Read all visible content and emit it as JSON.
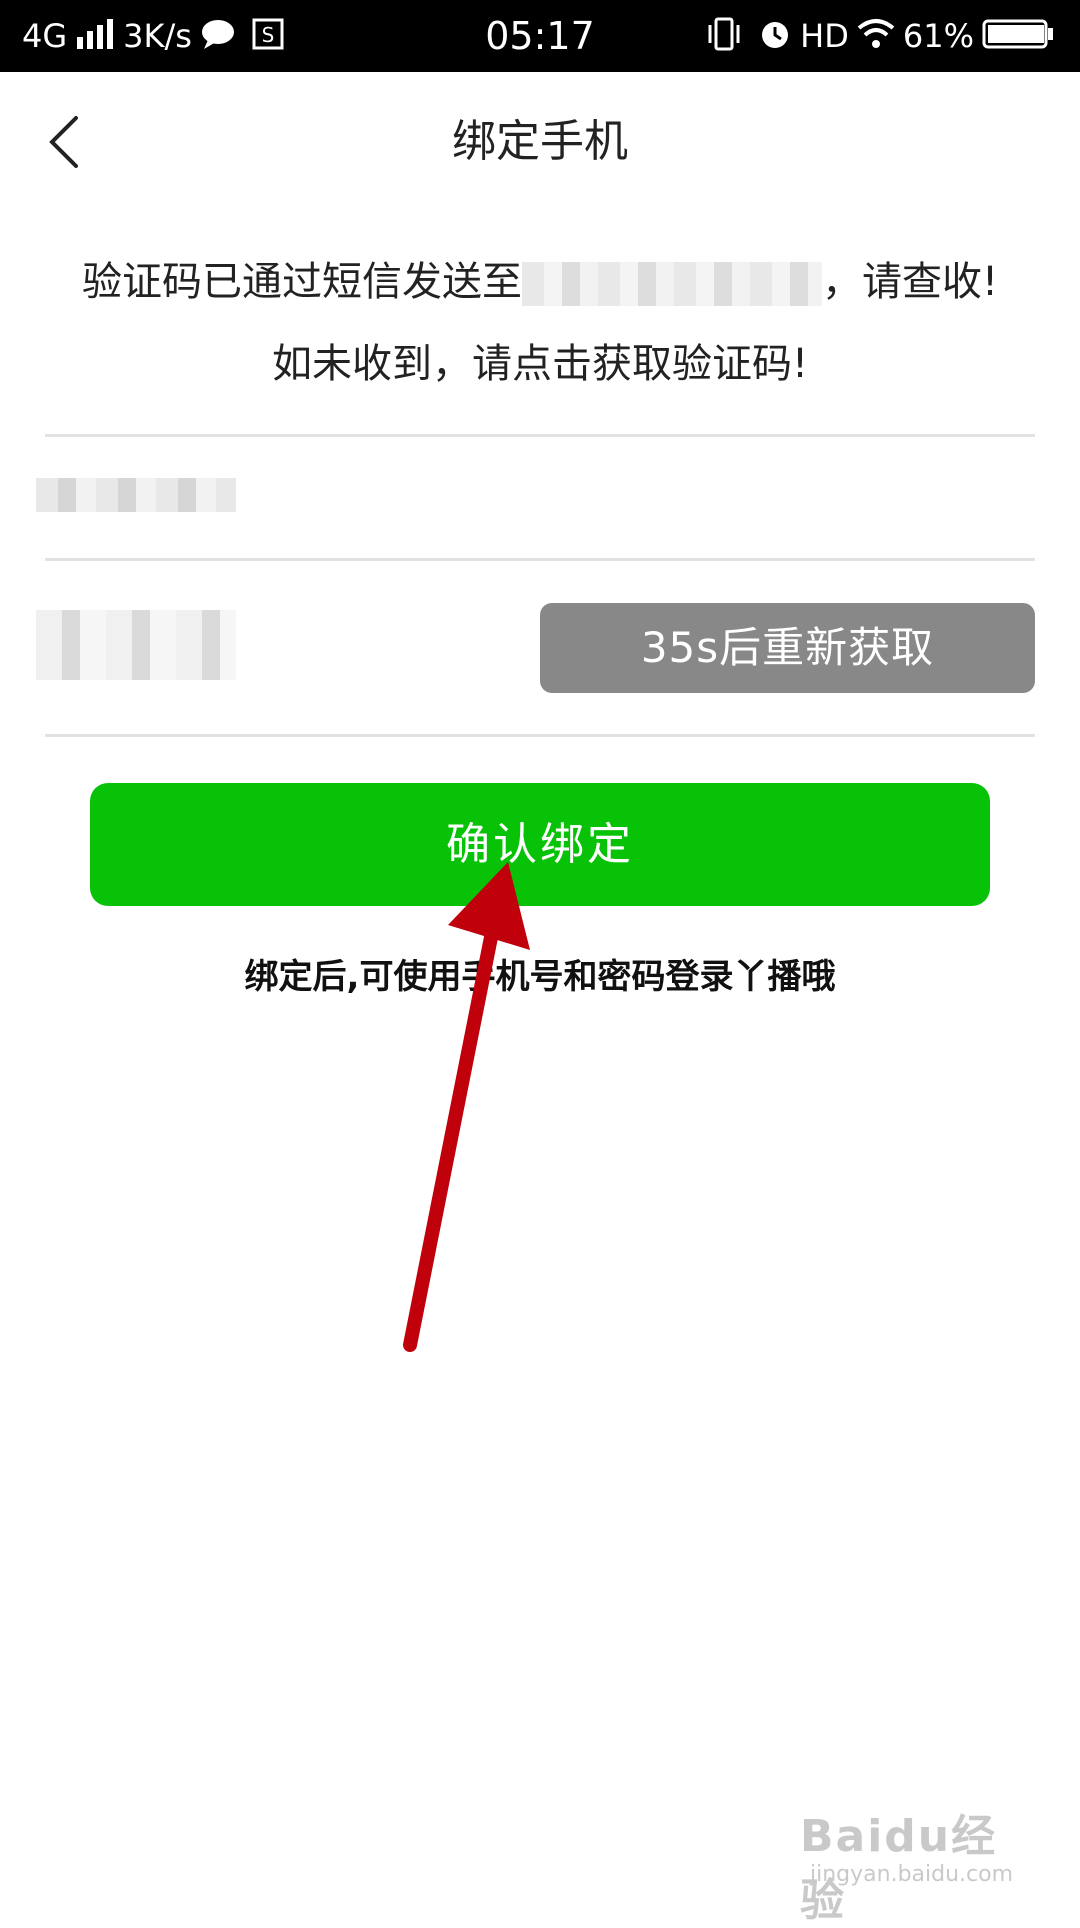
{
  "status_bar": {
    "network": "4G",
    "speed": "3K/s",
    "time": "05:17",
    "hd": "HD",
    "battery": "61%"
  },
  "header": {
    "title": "绑定手机"
  },
  "message": {
    "line1_prefix": "验证码已通过短信发送至",
    "line1_suffix": "，请查收!",
    "line2": "如未收到，请点击获取验证码!"
  },
  "form": {
    "resend_label": "35s后重新获取"
  },
  "confirm": {
    "label": "确认绑定"
  },
  "hint": "绑定后,可使用手机号和密码登录丫播哦",
  "watermark": {
    "brand": "Baidu经验",
    "site": "jingyan.baidu.com"
  },
  "colors": {
    "confirm": "#08c208",
    "resend": "#888888",
    "arrow": "#c0000a"
  }
}
